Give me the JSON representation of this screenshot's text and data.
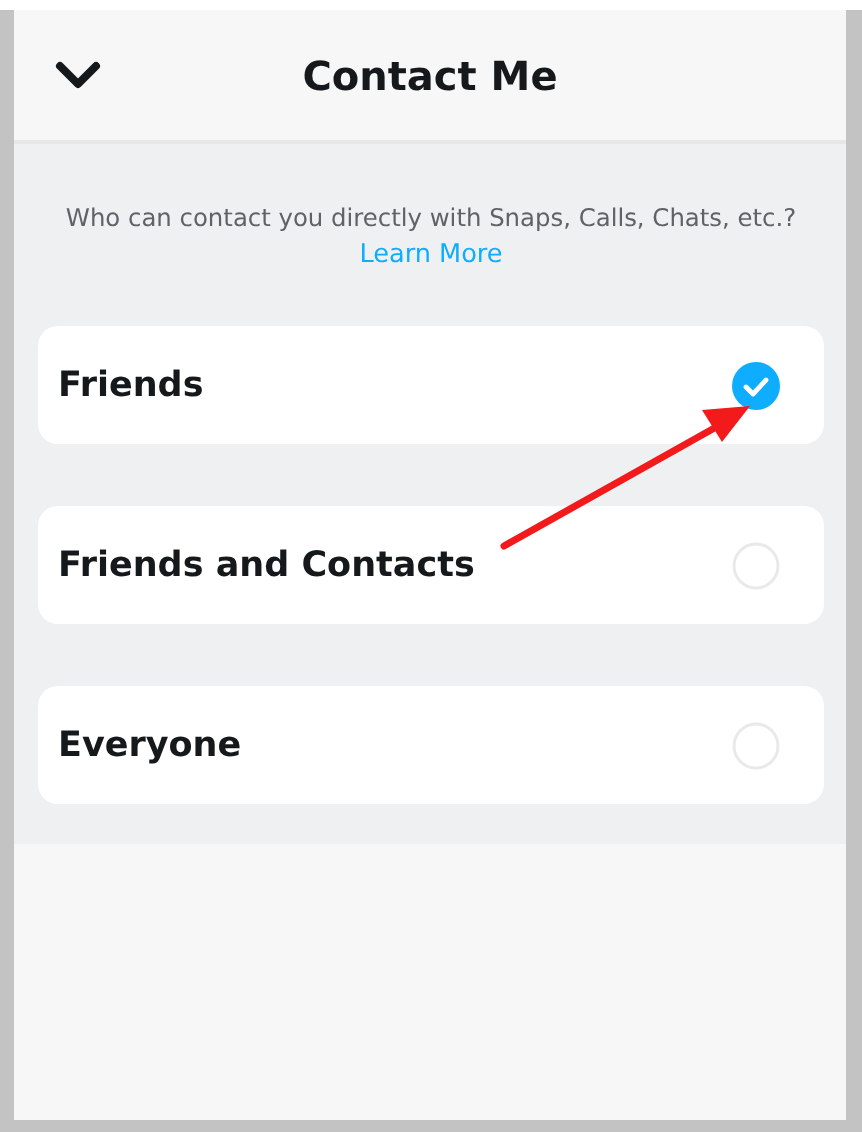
{
  "header": {
    "title": "Contact Me"
  },
  "description": "Who can contact you directly with Snaps, Calls, Chats, etc.?",
  "learn_more": "Learn More",
  "options": [
    {
      "label": "Friends",
      "selected": true
    },
    {
      "label": "Friends and Contacts",
      "selected": false
    },
    {
      "label": "Everyone",
      "selected": false
    }
  ]
}
